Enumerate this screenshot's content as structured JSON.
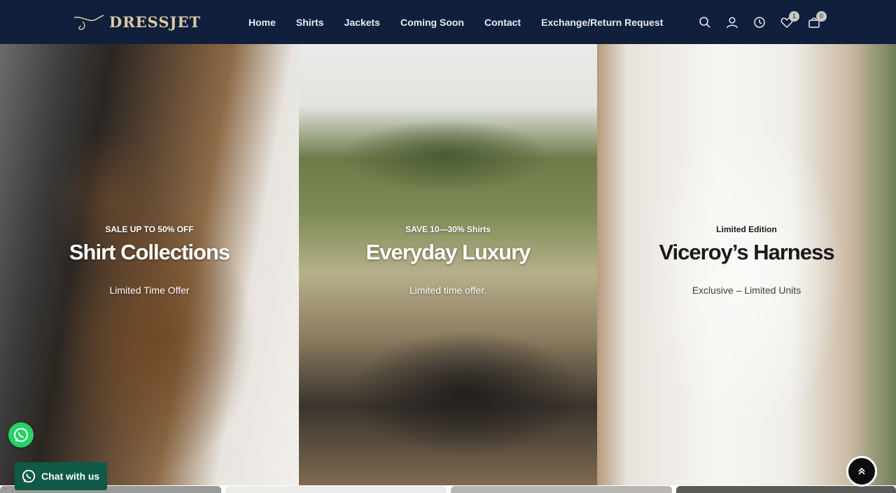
{
  "brand": {
    "name": "DRESSJET"
  },
  "nav": {
    "items": [
      {
        "label": "Home"
      },
      {
        "label": "Shirts"
      },
      {
        "label": "Jackets"
      },
      {
        "label": "Coming Soon"
      },
      {
        "label": "Contact"
      },
      {
        "label": "Exchange/Return Request"
      }
    ]
  },
  "header_icons": {
    "search": "search-icon",
    "account": "user-icon",
    "recent": "clock-icon",
    "wishlist": {
      "icon": "heart-icon",
      "count": "1"
    },
    "cart": {
      "icon": "bag-icon",
      "count": "0"
    }
  },
  "hero": {
    "panels": [
      {
        "eyebrow": "SALE UP TO 50% OFF",
        "title": "Shirt Collections",
        "subtitle": "Limited Time Offer"
      },
      {
        "eyebrow": "SAVE 10—30% Shirts",
        "title": "Everyday Luxury",
        "subtitle": "Limited time offer."
      },
      {
        "eyebrow": "Limited Edition",
        "title": "Viceroy’s Harness",
        "subtitle": "Exclusive – Limited Units"
      }
    ]
  },
  "chat": {
    "label": "Chat with us"
  },
  "colors": {
    "header_bg": "#0f1f3c",
    "logo_gold": "#d9c9a4",
    "whatsapp_green": "#25d366",
    "chat_bg": "#0f5a47"
  }
}
